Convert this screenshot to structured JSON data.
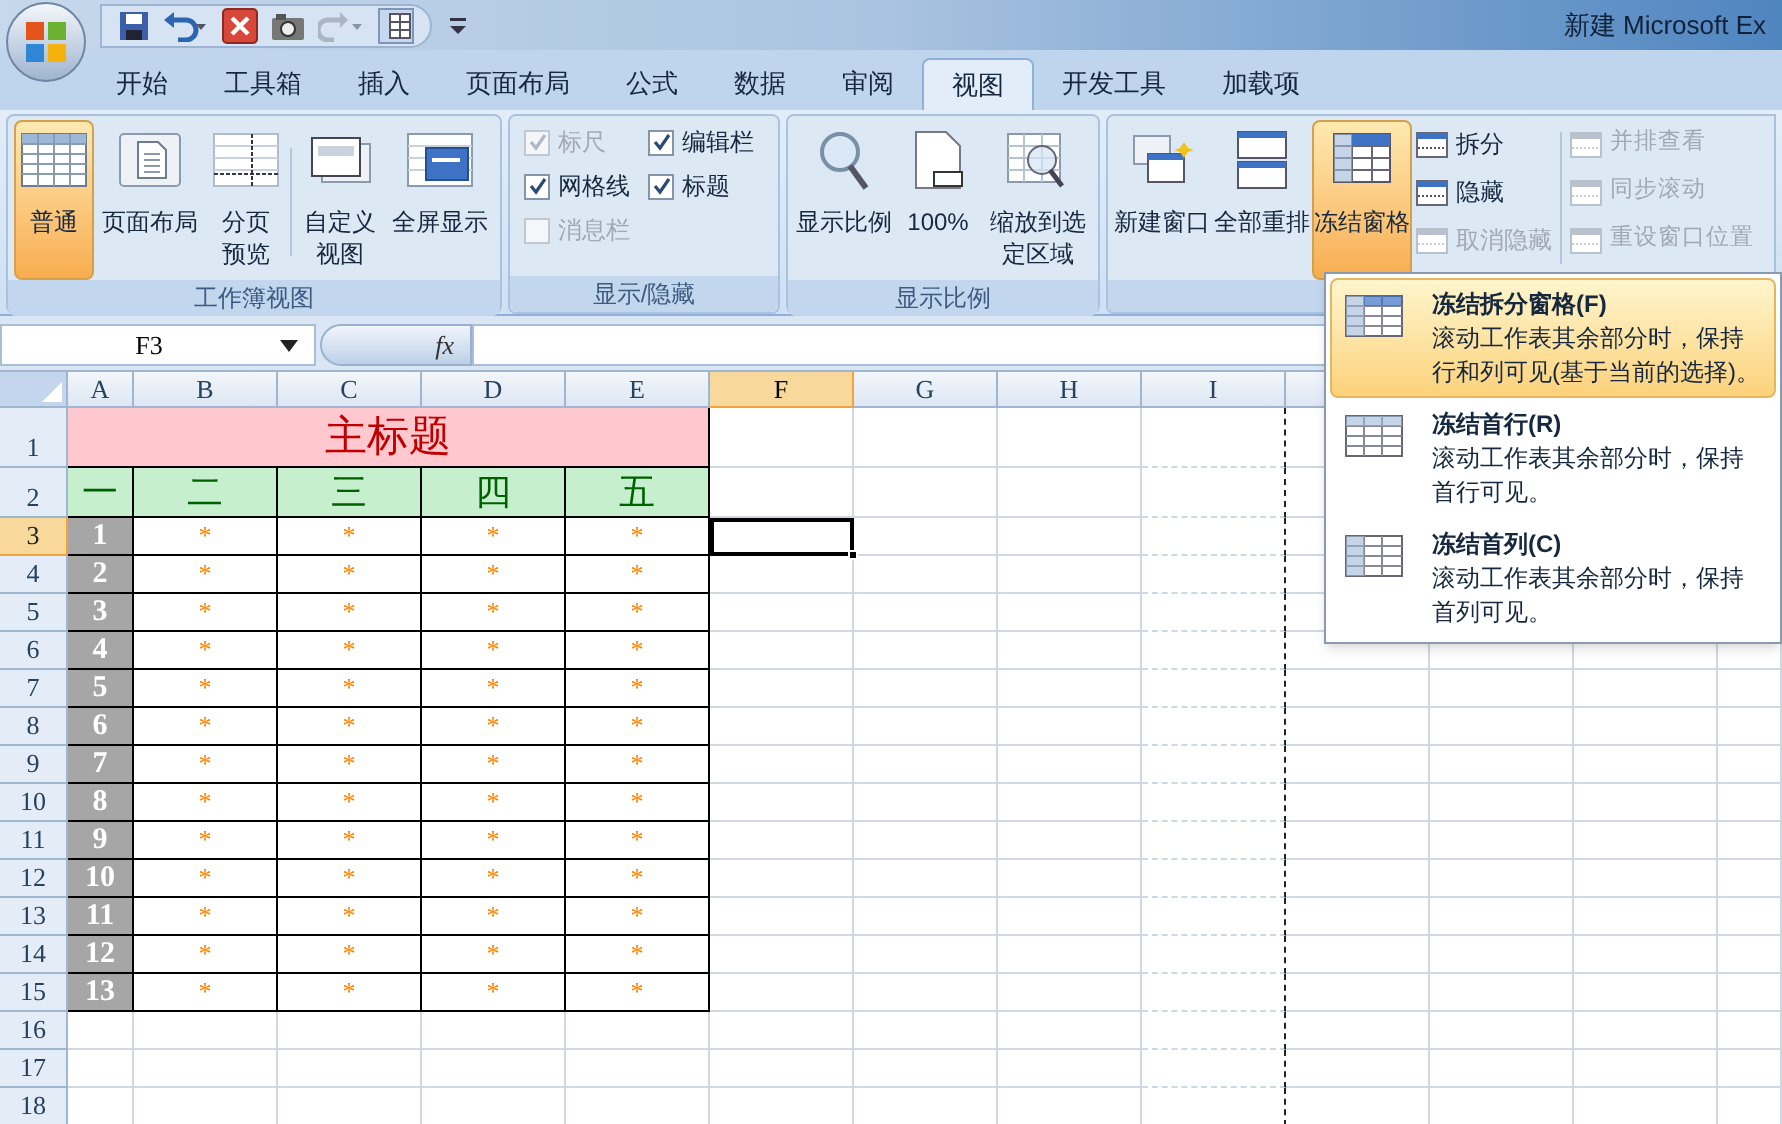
{
  "window": {
    "title": "新建 Microsoft Ex"
  },
  "tabs": [
    {
      "label": "开始",
      "selected": false
    },
    {
      "label": "工具箱",
      "selected": false
    },
    {
      "label": "插入",
      "selected": false
    },
    {
      "label": "页面布局",
      "selected": false
    },
    {
      "label": "公式",
      "selected": false
    },
    {
      "label": "数据",
      "selected": false
    },
    {
      "label": "审阅",
      "selected": false
    },
    {
      "label": "视图",
      "selected": true
    },
    {
      "label": "开发工具",
      "selected": false
    },
    {
      "label": "加载项",
      "selected": false
    }
  ],
  "ribbon": {
    "workbook_views": {
      "label": "工作簿视图",
      "buttons": [
        {
          "label": "普通",
          "selected": true
        },
        {
          "label": "页面布局",
          "selected": false
        },
        {
          "label": "分页预览",
          "selected": false
        },
        {
          "label": "自定义视图",
          "selected": false
        },
        {
          "label": "全屏显示",
          "selected": false
        }
      ]
    },
    "show_hide": {
      "label": "显示/隐藏",
      "checkboxes": [
        {
          "label": "标尺",
          "checked": true,
          "disabled": true
        },
        {
          "label": "编辑栏",
          "checked": true,
          "disabled": false
        },
        {
          "label": "网格线",
          "checked": true,
          "disabled": false
        },
        {
          "label": "标题",
          "checked": true,
          "disabled": false
        },
        {
          "label": "消息栏",
          "checked": false,
          "disabled": true
        }
      ]
    },
    "zoom": {
      "label": "显示比例",
      "buttons": [
        {
          "label": "显示比例"
        },
        {
          "label": "100%"
        },
        {
          "label": "缩放到选定区域"
        }
      ]
    },
    "window_group": {
      "buttons": [
        {
          "label": "新建窗口",
          "selected": false
        },
        {
          "label": "全部重排",
          "selected": false
        },
        {
          "label": "冻结窗格",
          "selected": true
        }
      ],
      "small_buttons": [
        {
          "label": "拆分",
          "disabled": false
        },
        {
          "label": "隐藏",
          "disabled": false
        },
        {
          "label": "取消隐藏",
          "disabled": true
        }
      ],
      "side_buttons": [
        {
          "label": "并排查看",
          "disabled": true
        },
        {
          "label": "同步滚动",
          "disabled": true
        },
        {
          "label": "重设窗口位置",
          "disabled": true
        }
      ]
    }
  },
  "formula_bar": {
    "name_box": "F3",
    "fx": "fx"
  },
  "sheet": {
    "columns": [
      {
        "label": "A",
        "selected": false
      },
      {
        "label": "B",
        "selected": false
      },
      {
        "label": "C",
        "selected": false
      },
      {
        "label": "D",
        "selected": false
      },
      {
        "label": "E",
        "selected": false
      },
      {
        "label": "F",
        "selected": true
      },
      {
        "label": "G",
        "selected": false
      },
      {
        "label": "H",
        "selected": false
      },
      {
        "label": "I",
        "selected": false
      }
    ],
    "row_numbers": [
      {
        "label": "1",
        "selected": false
      },
      {
        "label": "2",
        "selected": false
      },
      {
        "label": "3",
        "selected": true
      },
      {
        "label": "4",
        "selected": false
      },
      {
        "label": "5",
        "selected": false
      },
      {
        "label": "6",
        "selected": false
      },
      {
        "label": "7",
        "selected": false
      },
      {
        "label": "8",
        "selected": false
      },
      {
        "label": "9",
        "selected": false
      },
      {
        "label": "10",
        "selected": false
      },
      {
        "label": "11",
        "selected": false
      },
      {
        "label": "12",
        "selected": false
      },
      {
        "label": "13",
        "selected": false
      },
      {
        "label": "14",
        "selected": false
      },
      {
        "label": "15",
        "selected": false
      },
      {
        "label": "16",
        "selected": false
      },
      {
        "label": "17",
        "selected": false
      },
      {
        "label": "18",
        "selected": false
      }
    ],
    "title": "主标题",
    "headers": [
      "一",
      "二",
      "三",
      "四",
      "五"
    ],
    "rows": [
      {
        "cells": [
          "1",
          "*",
          "*",
          "*",
          "*"
        ]
      },
      {
        "cells": [
          "2",
          "*",
          "*",
          "*",
          "*"
        ]
      },
      {
        "cells": [
          "3",
          "*",
          "*",
          "*",
          "*"
        ]
      },
      {
        "cells": [
          "4",
          "*",
          "*",
          "*",
          "*"
        ]
      },
      {
        "cells": [
          "5",
          "*",
          "*",
          "*",
          "*"
        ]
      },
      {
        "cells": [
          "6",
          "*",
          "*",
          "*",
          "*"
        ]
      },
      {
        "cells": [
          "7",
          "*",
          "*",
          "*",
          "*"
        ]
      },
      {
        "cells": [
          "8",
          "*",
          "*",
          "*",
          "*"
        ]
      },
      {
        "cells": [
          "9",
          "*",
          "*",
          "*",
          "*"
        ]
      },
      {
        "cells": [
          "10",
          "*",
          "*",
          "*",
          "*"
        ]
      },
      {
        "cells": [
          "11",
          "*",
          "*",
          "*",
          "*"
        ]
      },
      {
        "cells": [
          "12",
          "*",
          "*",
          "*",
          "*"
        ]
      },
      {
        "cells": [
          "13",
          "*",
          "*",
          "*",
          "*"
        ]
      }
    ]
  },
  "freeze_menu": {
    "items": [
      {
        "title": "冻结拆分窗格(F)",
        "description": "滚动工作表其余部分时，保持行和列可见(基于当前的选择)。",
        "selected": true
      },
      {
        "title": "冻结首行(R)",
        "description": "滚动工作表其余部分时，保持首行可见。",
        "selected": false
      },
      {
        "title": "冻结首列(C)",
        "description": "滚动工作表其余部分时，保持首列可见。",
        "selected": false
      }
    ]
  }
}
